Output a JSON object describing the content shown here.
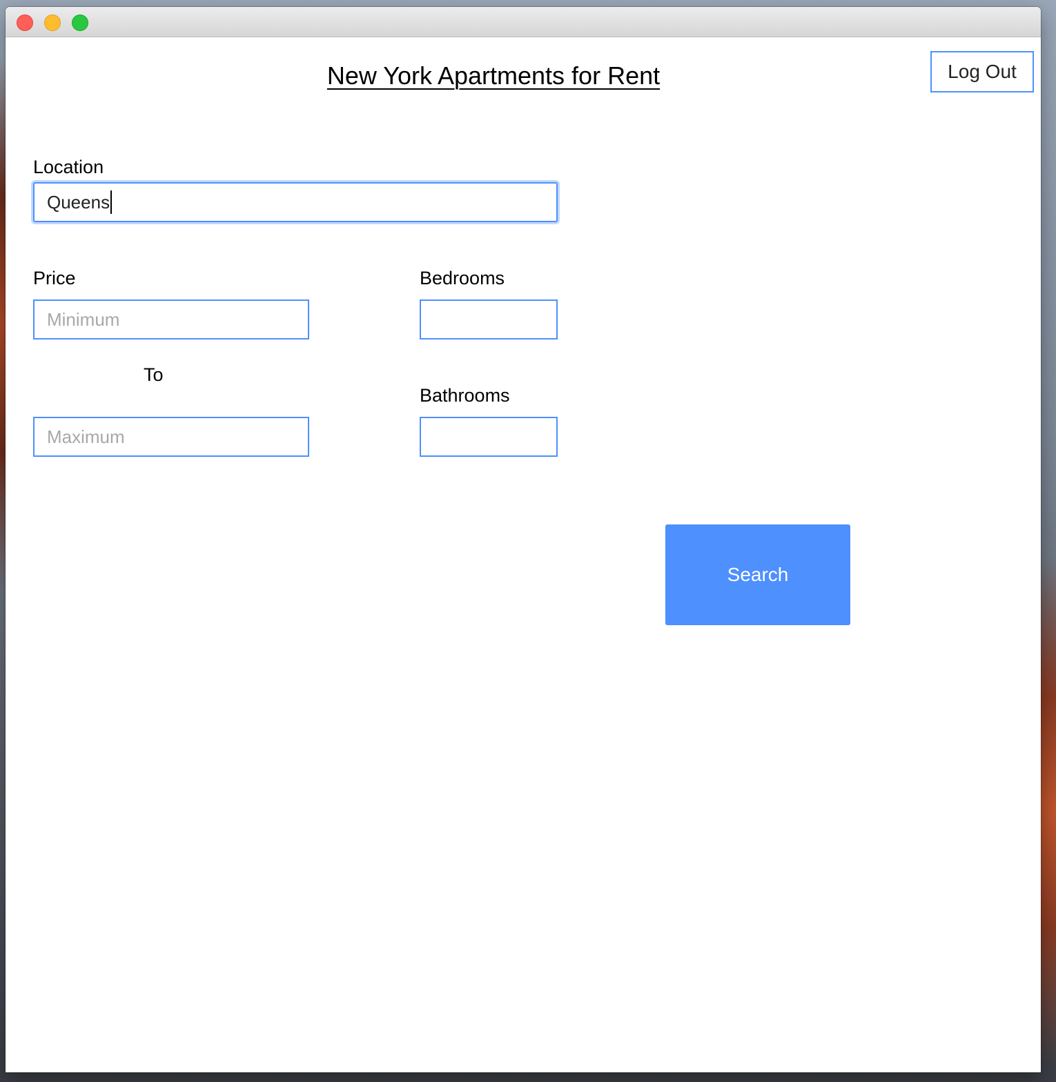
{
  "window": {
    "controls": [
      "close",
      "minimize",
      "maximize"
    ]
  },
  "header": {
    "title": "New York Apartments for Rent",
    "logout_label": "Log Out"
  },
  "form": {
    "location": {
      "label": "Location",
      "value": "Queens"
    },
    "price": {
      "label": "Price",
      "min_placeholder": "Minimum",
      "separator": "To",
      "max_placeholder": "Maximum"
    },
    "bedrooms": {
      "label": "Bedrooms",
      "value": ""
    },
    "bathrooms": {
      "label": "Bathrooms",
      "value": ""
    },
    "search_label": "Search"
  },
  "colors": {
    "accent": "#4d90fe",
    "placeholder": "#a8a8a8"
  }
}
